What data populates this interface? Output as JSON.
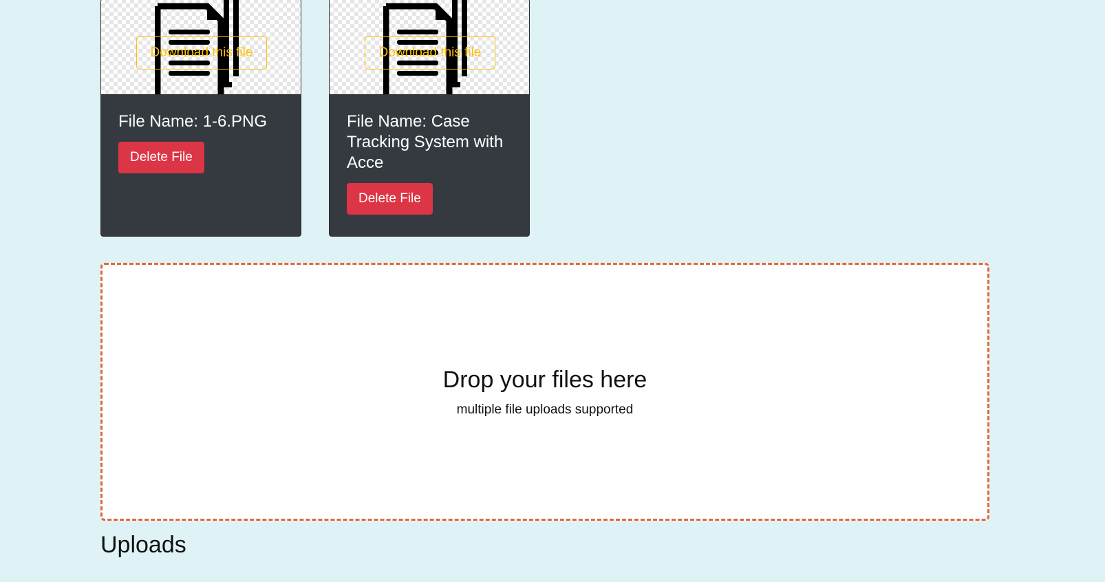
{
  "files": [
    {
      "download_label": "Download this file",
      "name_text": "File Name: 1-6.PNG",
      "delete_label": "Delete File",
      "thumbnail_icon": "document-stack-icon"
    },
    {
      "download_label": "Download this file",
      "name_text": "File Name: Case Tracking System with Acce",
      "delete_label": "Delete File",
      "thumbnail_icon": "document-stack-icon"
    }
  ],
  "dropzone": {
    "title": "Drop your files here",
    "subtitle": "multiple file uploads supported"
  },
  "uploads_heading": "Uploads",
  "colors": {
    "page_background": "#dff3f6",
    "card_background": "#343a40",
    "download_outline": "#ffc107",
    "delete_button": "#dc3545",
    "dropzone_border": "#e0683b"
  }
}
